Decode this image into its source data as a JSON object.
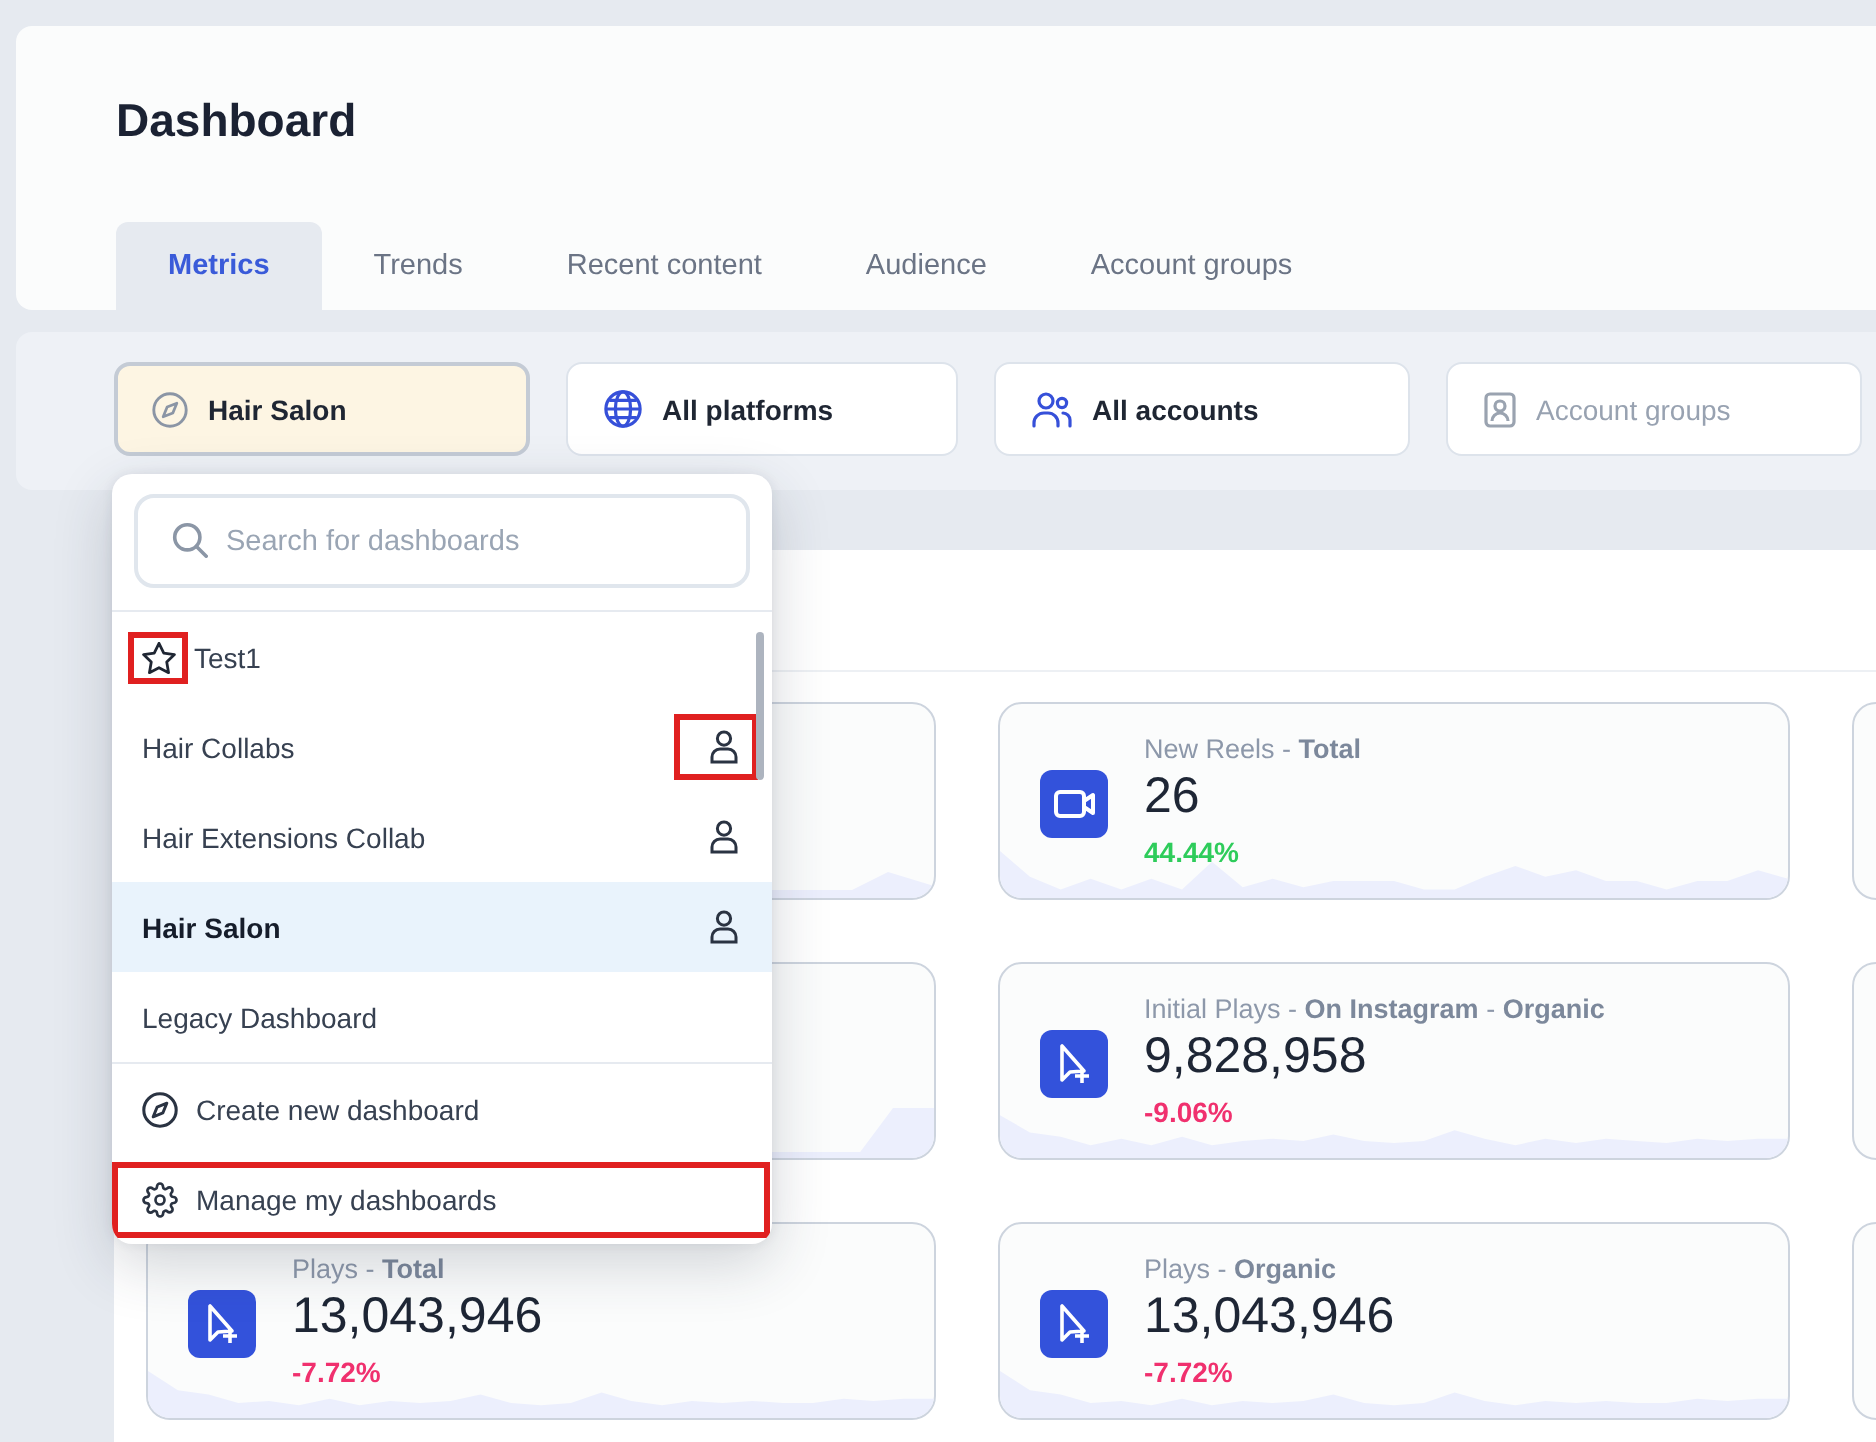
{
  "page": {
    "title": "Dashboard"
  },
  "tabs": [
    {
      "label": "Metrics",
      "selected": true
    },
    {
      "label": "Trends",
      "selected": false
    },
    {
      "label": "Recent content",
      "selected": false
    },
    {
      "label": "Audience",
      "selected": false
    },
    {
      "label": "Account groups",
      "selected": false
    }
  ],
  "filters": [
    {
      "kind": "dashboard",
      "label": "Hair Salon",
      "selected": true,
      "disabled": false
    },
    {
      "kind": "platforms",
      "label": "All platforms",
      "selected": false,
      "disabled": false
    },
    {
      "kind": "accounts",
      "label": "All accounts",
      "selected": false,
      "disabled": false
    },
    {
      "kind": "groups",
      "label": "Account groups",
      "selected": false,
      "disabled": true
    }
  ],
  "dashboard_menu": {
    "search": {
      "placeholder": "Search for dashboards"
    },
    "items": [
      {
        "kind": "starred",
        "label": "Test1",
        "selected": false,
        "icon": {
          "marked": true
        }
      },
      {
        "kind": "shared",
        "label": "Hair Collabs",
        "selected": false,
        "icon": {
          "marked": true
        }
      },
      {
        "kind": "shared",
        "label": "Hair Extensions Collab",
        "selected": false,
        "icon": {
          "marked": false
        }
      },
      {
        "kind": "shared",
        "label": "Hair Salon",
        "selected": true,
        "icon": {
          "marked": false
        }
      },
      {
        "kind": "plain",
        "label": "Legacy Dashboard",
        "selected": false
      }
    ],
    "actions": [
      {
        "kind": "create",
        "label": "Create new dashboard",
        "marked": false
      },
      {
        "kind": "manage",
        "label": "Manage my dashboards",
        "marked": true
      }
    ]
  },
  "cards": [
    {
      "kind": "covered"
    },
    {
      "kind": "reels",
      "label": "New Reels - **Total**",
      "value": "26",
      "change": "44.44%",
      "positive": true
    },
    {
      "kind": "cut"
    },
    {
      "kind": "covered"
    },
    {
      "kind": "plays",
      "label": "Initial Plays - **On Instagram** - **Organic**",
      "value": "9,828,958",
      "change": "-9.06%",
      "positive": false
    },
    {
      "kind": "cut"
    },
    {
      "kind": "plays",
      "label": "Plays - **Total**",
      "value": "13,043,946",
      "change": "-7.72%",
      "positive": false
    },
    {
      "kind": "plays",
      "label": "Plays - **Organic**",
      "value": "13,043,946",
      "change": "-7.72%",
      "positive": false
    },
    {
      "kind": "cut"
    }
  ]
}
